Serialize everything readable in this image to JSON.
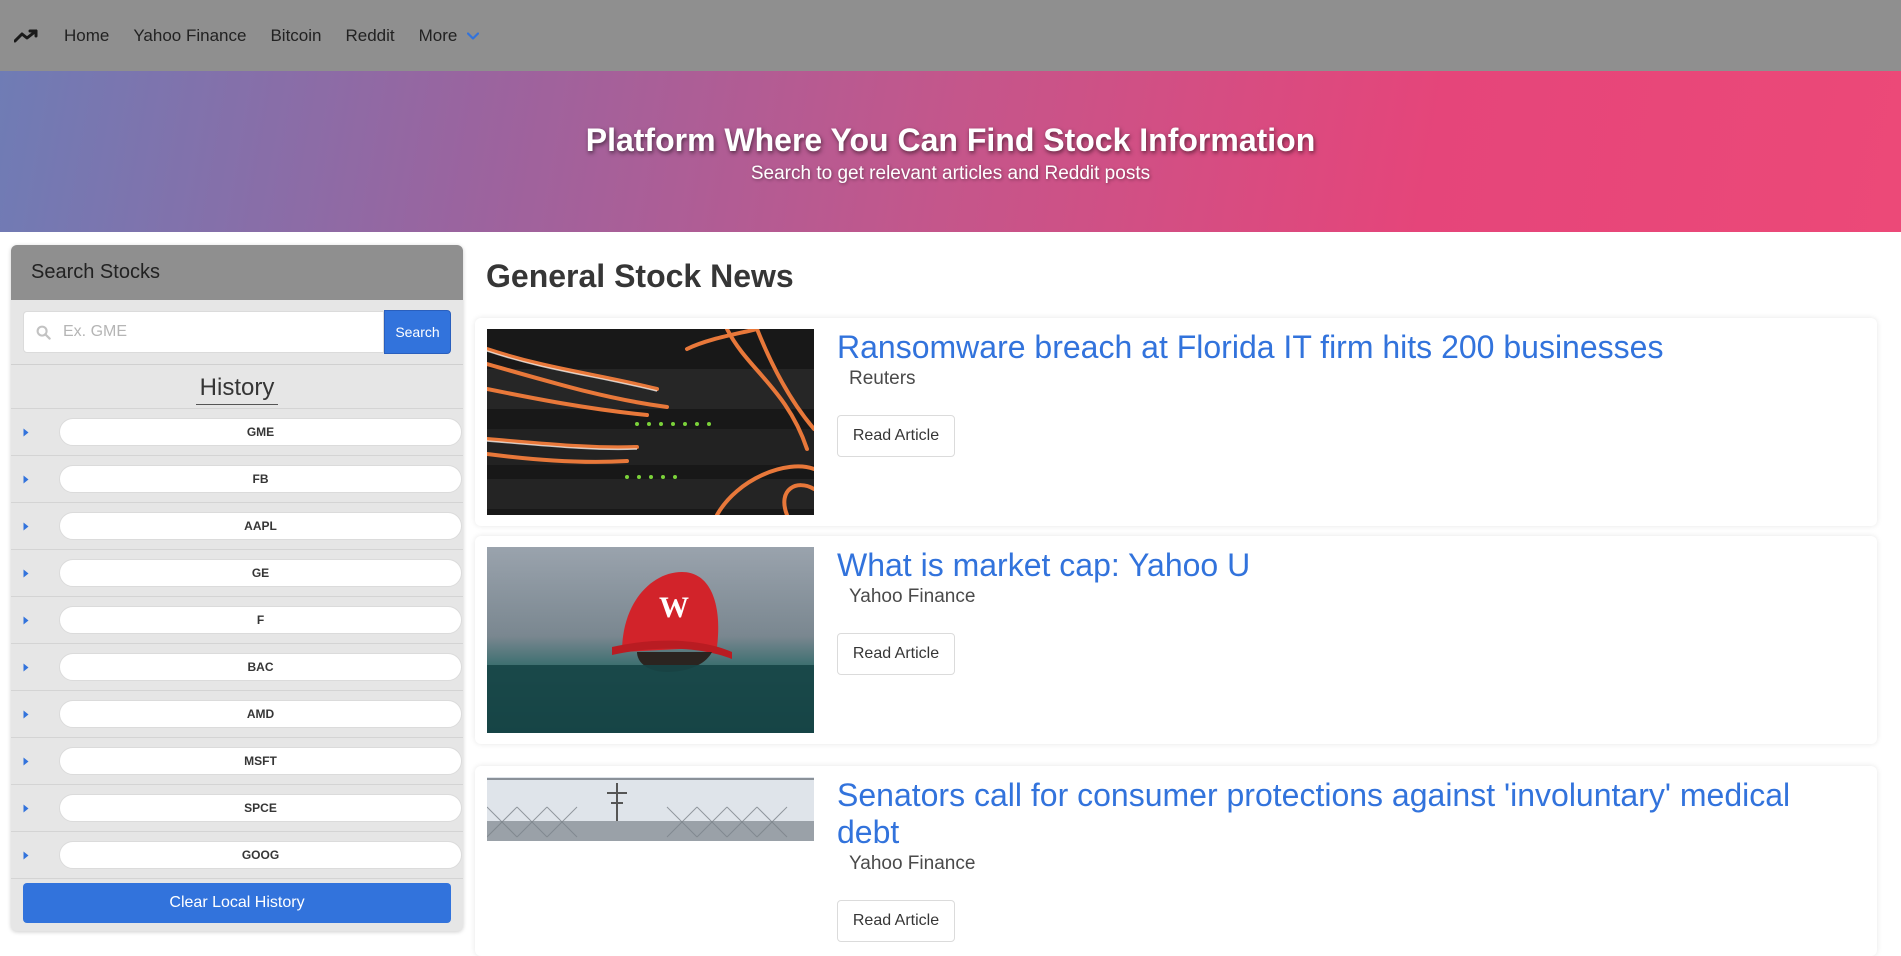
{
  "navbar": {
    "logo_icon": "trending-up-icon",
    "items": [
      {
        "label": "Home"
      },
      {
        "label": "Yahoo Finance"
      },
      {
        "label": "Bitcoin"
      },
      {
        "label": "Reddit"
      }
    ],
    "more_label": "More"
  },
  "hero": {
    "title": "Platform Where You Can Find Stock Information",
    "subtitle": "Search to get relevant articles and Reddit posts"
  },
  "sidebar": {
    "title": "Search Stocks",
    "search_placeholder": "Ex. GME",
    "search_button": "Search",
    "history_title": "History",
    "history": [
      "GME",
      "FB",
      "AAPL",
      "GE",
      "F",
      "BAC",
      "AMD",
      "MSFT",
      "SPCE",
      "GOOG"
    ],
    "clear_button": "Clear Local History"
  },
  "main": {
    "title": "General Stock News",
    "articles": [
      {
        "headline": "Ransomware breach at Florida IT firm hits 200 businesses",
        "source": "Reuters",
        "button": "Read Article"
      },
      {
        "headline": "What is market cap: Yahoo U",
        "source": "Yahoo Finance",
        "button": "Read Article"
      },
      {
        "headline": "Senators call for consumer protections against 'involuntary' medical debt",
        "source": "Yahoo Finance",
        "button": "Read Article"
      }
    ]
  },
  "colors": {
    "primary": "#3273dc",
    "navbar": "#8f8f8f",
    "hero_start": "#6f7cb5",
    "hero_end": "#ec4978"
  }
}
